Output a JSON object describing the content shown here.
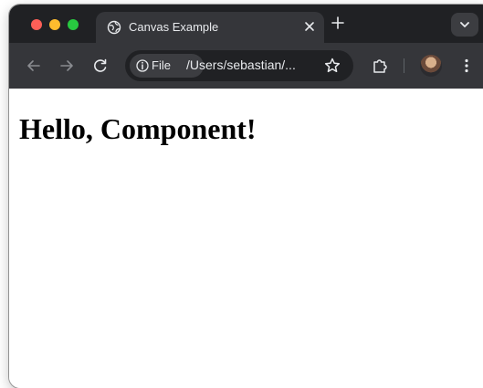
{
  "browser": {
    "tab": {
      "title": "Canvas Example"
    },
    "omnibox": {
      "chip_label": "File",
      "url": "/Users/sebastian/..."
    },
    "colors": {
      "frame": "#202124",
      "toolbar": "#35363a",
      "text": "#e8eaed",
      "close": "#ff5f57",
      "minimize": "#febc2e",
      "zoom": "#28c840"
    },
    "icons": {
      "tab": "globe-icon",
      "close": "close-icon",
      "new_tab": "plus-icon",
      "tab_search": "chevron-down-icon",
      "back": "arrow-left-icon",
      "forward": "arrow-right-icon",
      "reload": "reload-icon",
      "site_info": "info-icon",
      "bookmark": "star-icon",
      "extensions": "puzzle-icon",
      "menu": "kebab-menu-icon"
    }
  },
  "page": {
    "heading": "Hello, Component!"
  }
}
